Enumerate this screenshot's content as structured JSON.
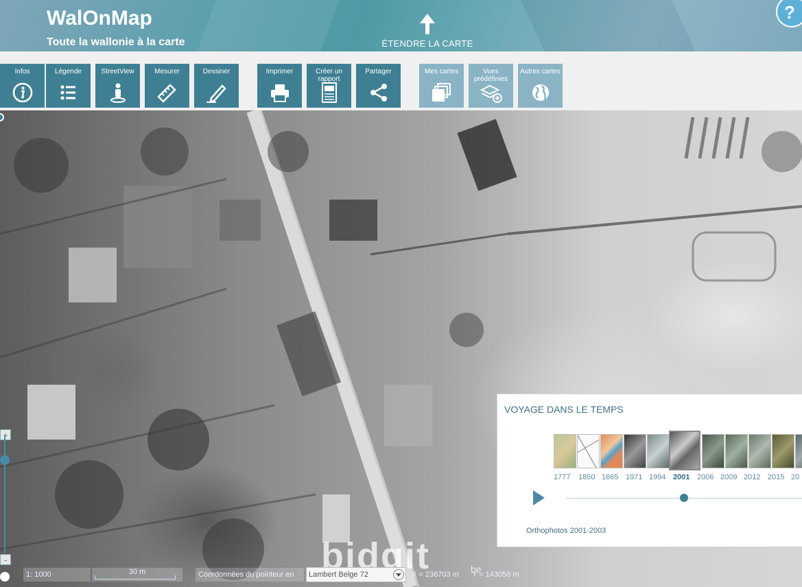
{
  "header": {
    "title": "WalOnMap",
    "subtitle": "Toute la wallonie à la carte",
    "expand_label": "ÉTENDRE LA CARTE",
    "help_label": "?"
  },
  "toolbar": {
    "tools": [
      {
        "label": "Infos",
        "icon": "info-icon"
      },
      {
        "label": "Légende",
        "icon": "list-icon"
      },
      {
        "label": "StreetView",
        "icon": "person-icon"
      },
      {
        "label": "Mesurer",
        "icon": "ruler-icon"
      },
      {
        "label": "Dessiner",
        "icon": "pencil-icon"
      },
      {
        "label": "Imprimer",
        "icon": "printer-icon"
      },
      {
        "label": "Créer un rapport",
        "icon": "report-icon"
      },
      {
        "label": "Partager",
        "icon": "share-icon"
      },
      {
        "label": "Mes cartes",
        "icon": "maps-icon"
      },
      {
        "label": "Vues prédéfinies",
        "icon": "layers-icon"
      },
      {
        "label": "Autres cartes",
        "icon": "globe-icon"
      }
    ]
  },
  "time_travel": {
    "title": "VOYAGE DANS LE TEMPS",
    "years": [
      "1777",
      "1850",
      "1865",
      "1971",
      "1994",
      "2001",
      "2006",
      "2009",
      "2012",
      "2015",
      "20"
    ],
    "selected_year": "2001",
    "caption": "Orthophotos 2001-2003"
  },
  "zoom": {
    "zoom_in": "+",
    "zoom_out": "-"
  },
  "status": {
    "scale": "1: 1000",
    "scale_bar": "30 m",
    "pointer_label": "Coordonnées du pointeur en",
    "projection": "Lambert Belge 72",
    "x_label": "X = 238703 m",
    "y_label": "Y = 143058 m"
  },
  "watermark": {
    "brand": "bidgit",
    "suffix": "be"
  }
}
